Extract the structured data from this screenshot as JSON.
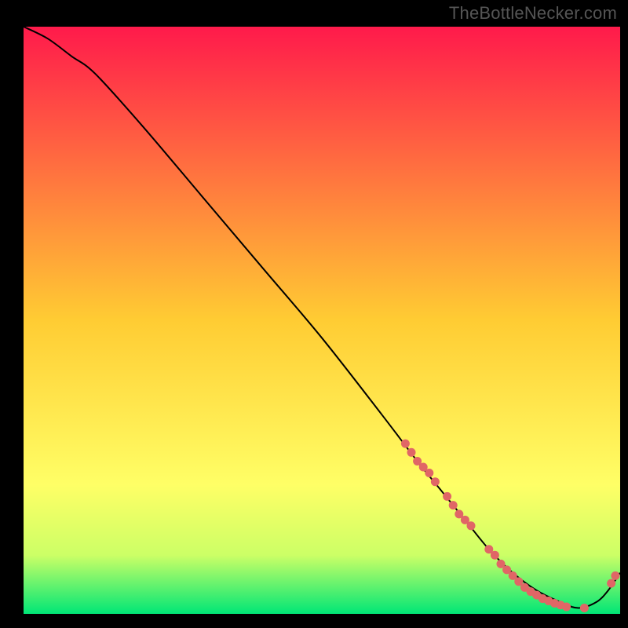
{
  "watermark": "TheBottleNecker.com",
  "chart_data": {
    "type": "line",
    "title": "",
    "xlabel": "",
    "ylabel": "",
    "xlim": [
      0,
      100
    ],
    "ylim": [
      0,
      100
    ],
    "grid": false,
    "legend": false,
    "background_gradient": {
      "stops": [
        {
          "offset": 0.0,
          "color": "#ff1a4b"
        },
        {
          "offset": 0.5,
          "color": "#ffcc33"
        },
        {
          "offset": 0.78,
          "color": "#ffff66"
        },
        {
          "offset": 0.9,
          "color": "#ccff66"
        },
        {
          "offset": 1.0,
          "color": "#00e676"
        }
      ]
    },
    "series": [
      {
        "name": "curve",
        "type": "line",
        "color": "#000000",
        "x": [
          0,
          4,
          8,
          12,
          20,
          30,
          40,
          50,
          60,
          66,
          70,
          74,
          78,
          82,
          86,
          90,
          93,
          96,
          98,
          100
        ],
        "y": [
          100,
          98,
          95,
          92,
          83,
          71,
          59,
          47,
          34,
          26,
          21,
          16,
          11,
          7,
          4,
          2,
          1,
          2,
          4,
          7
        ]
      },
      {
        "name": "dots",
        "type": "scatter",
        "color": "#e06666",
        "x": [
          64,
          65,
          66,
          67,
          68,
          69,
          71,
          72,
          73,
          74,
          75,
          78,
          79,
          80,
          81,
          82,
          83,
          84,
          85,
          86,
          87,
          88,
          89,
          90,
          91,
          94,
          98.5,
          99.2
        ],
        "y": [
          29,
          27.5,
          26,
          25,
          24,
          22.5,
          20,
          18.5,
          17,
          16,
          15,
          11,
          10,
          8.5,
          7.5,
          6.5,
          5.5,
          4.5,
          3.8,
          3.2,
          2.6,
          2.2,
          1.8,
          1.5,
          1.2,
          1.0,
          5.2,
          6.5
        ]
      }
    ]
  }
}
